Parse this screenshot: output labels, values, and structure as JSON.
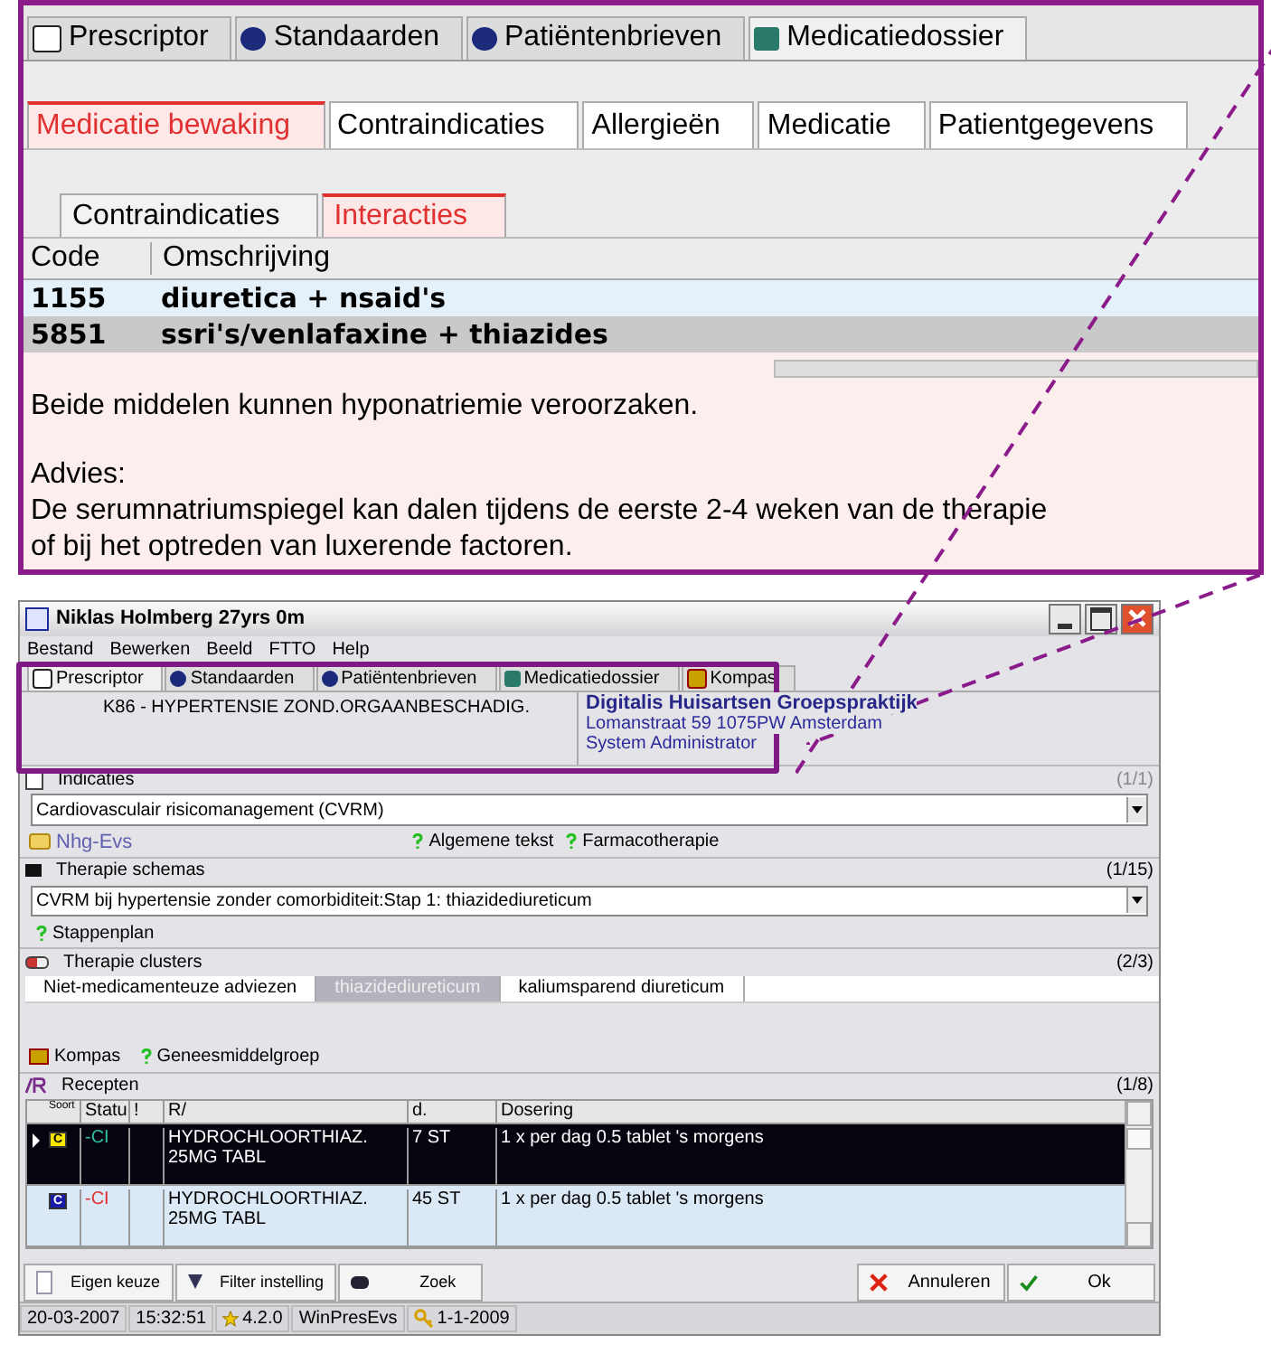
{
  "callout": {
    "top_tabs": [
      {
        "label": "Prescriptor",
        "selected": false
      },
      {
        "label": "Standaarden",
        "selected": false
      },
      {
        "label": "Patiëntenbrieven",
        "selected": false
      },
      {
        "label": "Medicatiedossier",
        "selected": true
      }
    ],
    "sub_tabs": [
      {
        "label": "Medicatie bewaking",
        "selected": true
      },
      {
        "label": "Contraindicaties",
        "selected": false
      },
      {
        "label": "Allergieën",
        "selected": false
      },
      {
        "label": "Medicatie",
        "selected": false
      },
      {
        "label": "Patientgegevens",
        "selected": false
      }
    ],
    "inner_tabs": [
      {
        "label": "Contraindicaties",
        "selected": false
      },
      {
        "label": "Interacties",
        "selected": true
      }
    ],
    "columns": [
      "Code",
      "Omschrijving"
    ],
    "rows": [
      {
        "code": "1155",
        "description": "diuretica + nsaid's",
        "selected": false
      },
      {
        "code": "5851",
        "description": "ssri's/venlafaxine + thiazides",
        "selected": true
      }
    ],
    "note": [
      "Beide middelen kunnen hyponatriemie veroorzaken.",
      "Advies:",
      "De serumnatriumspiegel kan dalen tijdens de eerste 2-4 weken van de therapie",
      "of bij het optreden van luxerende factoren."
    ]
  },
  "window": {
    "title": "Niklas Holmberg 27yrs 0m",
    "menu": [
      "Bestand",
      "Bewerken",
      "Beeld",
      "FTTO",
      "Help"
    ],
    "tabs": [
      {
        "label": "Prescriptor",
        "selected": true
      },
      {
        "label": "Standaarden",
        "selected": false
      },
      {
        "label": "Patiëntenbrieven",
        "selected": false
      },
      {
        "label": "Medicatiedossier",
        "selected": false
      },
      {
        "label": "Kompas",
        "selected": false
      }
    ],
    "diagnosis": "K86 - HYPERTENSIE ZOND.ORGAANBESCHADIG.",
    "practice": {
      "name": "Digitalis Huisartsen Groepspraktijk",
      "address": "Lomanstraat 59 1075PW Amsterdam",
      "user": "System Administrator"
    },
    "indicaties": {
      "title": "Indicaties",
      "count": "(1/1)",
      "value": "Cardiovasculair risicomanagement (CVRM)",
      "folder_link": "Nhg-Evs",
      "help_links": [
        "Algemene tekst",
        "Farmacotherapie"
      ]
    },
    "schemas": {
      "title": "Therapie schemas",
      "count": "(1/15)",
      "value": "CVRM bij hypertensie zonder comorbiditeit:Stap 1: thiazidediureticum",
      "help_links": [
        "Stappenplan"
      ]
    },
    "clusters": {
      "title": "Therapie clusters",
      "count": "(2/3)",
      "tabs": [
        {
          "label": "Niet-medicamenteuze adviezen",
          "selected": false
        },
        {
          "label": "thiazidediureticum",
          "selected": true
        },
        {
          "label": "kaliumsparend diureticum",
          "selected": false
        }
      ],
      "kompas": "Kompas",
      "help_links": [
        "Geneesmiddelgroep"
      ]
    },
    "recepten": {
      "title": "Recepten",
      "count": "(1/8)",
      "columns": [
        "Soort",
        "Statu",
        "!",
        "R/",
        "d.",
        "Dosering"
      ],
      "rows": [
        {
          "selected": true,
          "badge": "C",
          "color": "#f5e600",
          "status": "-CI",
          "drug": "HYDROCHLOORTHIAZ. 25MG TABL",
          "amount": "7 ST",
          "dosage": "1 x per dag 0.5 tablet 's morgens"
        },
        {
          "selected": false,
          "badge": "C",
          "color": "#1a1aa8",
          "status": "-CI",
          "drug": "HYDROCHLOORTHIAZ. 25MG TABL",
          "amount": "45 ST",
          "dosage": "1 x per dag 0.5 tablet 's morgens"
        }
      ]
    },
    "buttons_left": [
      "Eigen keuze",
      "Filter instelling",
      "Zoek"
    ],
    "buttons_right": [
      "Annuleren",
      "Ok"
    ],
    "status_bar": [
      "20-03-2007",
      "15:32:51",
      "4.2.0",
      "WinPresEvs",
      "1-1-2009"
    ]
  }
}
